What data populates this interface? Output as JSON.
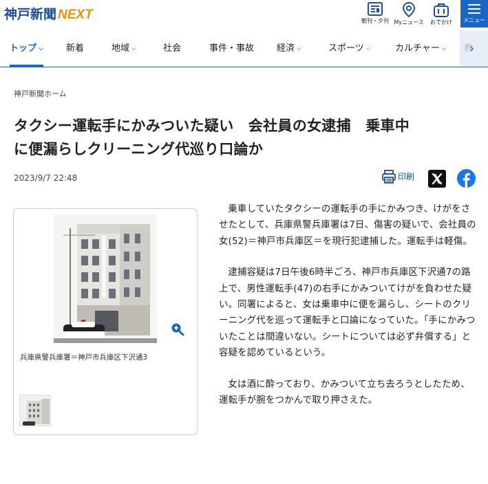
{
  "header": {
    "logo_main": "神戸新聞",
    "logo_next": "NEXT",
    "utils": [
      {
        "icon": "newspaper-icon",
        "label": "朝刊・夕刊"
      },
      {
        "icon": "location-pin-icon",
        "label": "Myニュース"
      },
      {
        "icon": "bag-icon",
        "label": "おでかけ"
      }
    ],
    "menu_label": "メニュー"
  },
  "nav": {
    "items": [
      {
        "label": "トップ",
        "chevron": "⌵"
      },
      {
        "label": "新着",
        "chevron": ""
      },
      {
        "label": "地域",
        "chevron": "⌵"
      },
      {
        "label": "社会",
        "chevron": ""
      },
      {
        "label": "事件・事故",
        "chevron": ""
      },
      {
        "label": "経済",
        "chevron": "⌵"
      },
      {
        "label": "スポーツ",
        "chevron": "⌵"
      },
      {
        "label": "カルチャー",
        "chevron": "⌵"
      }
    ],
    "ghost": "教",
    "scroll_arrow": "›"
  },
  "breadcrumb": "神戸新聞ホーム",
  "article": {
    "title_line1": "タクシー運転手にかみついた疑い　会社員の女逮捕　乗車中",
    "title_line2": "に便漏らしクリーニング代巡り口論か",
    "date": "2023/9/7 22:48",
    "print_label": "印刷",
    "caption": "兵庫県警兵庫署＝神戸市兵庫区下沢通3",
    "paragraphs": [
      "乗車していたタクシーの運転手の手にかみつき、けがをさせたとして、兵庫県警兵庫署は7日、傷害の疑いで、会社員の女(52)＝神戸市兵庫区＝を現行犯逮捕した。運転手は軽傷。",
      "逮捕容疑は7日午後6時半ごろ、神戸市兵庫区下沢通7の路上で、男性運転手(47)の右手にかみついてけがを負わせた疑い。同署によると、女は乗車中に便を漏らし、シートのクリーニング代を巡って運転手と口論になっていた。「手にかみついたことは間違いない。シートについては必ず弁償する」と容疑を認めているという。",
      "女は酒に酔っており、かみついて立ち去ろうとしたため、運転手が腕をつかんで取り押さえた。"
    ]
  },
  "colors": {
    "brand_blue": "#1a66c8",
    "logo_blue": "#1a4e9c",
    "logo_orange": "#f29100",
    "facebook": "#1877f2"
  }
}
